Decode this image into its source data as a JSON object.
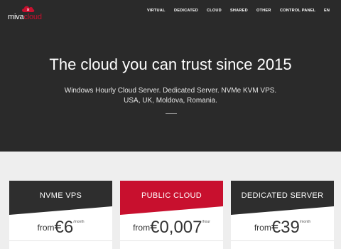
{
  "brand": {
    "part1": "miva",
    "part2": "cloud"
  },
  "nav": [
    "VIRTUAL",
    "DEDICATED",
    "CLOUD",
    "SHARED",
    "OTHER",
    "CONTROL PANEL",
    "EN"
  ],
  "hero": {
    "title": "The cloud you can trust since 2015",
    "subtitle_line1": "Windows Hourly Cloud Server. Dedicated Server. NVMe KVM VPS.",
    "subtitle_line2": "USA, UK, Moldova, Romania."
  },
  "plans": [
    {
      "title": "NVME VPS",
      "from": "from",
      "price": "€6",
      "unit": "/month",
      "header_color": "#2e2e2e"
    },
    {
      "title": "PUBLIC CLOUD",
      "from": "from",
      "price": "€0,007",
      "unit": "/hour",
      "header_color": "#c8102e"
    },
    {
      "title": "DEDICATED SERVER",
      "from": "from",
      "price": "€39",
      "unit": "/month",
      "header_color": "#2e2e2e"
    }
  ],
  "colors": {
    "hero_bg": "#2a2a2a",
    "accent": "#c8102e",
    "page_bg": "#eeeeee"
  }
}
